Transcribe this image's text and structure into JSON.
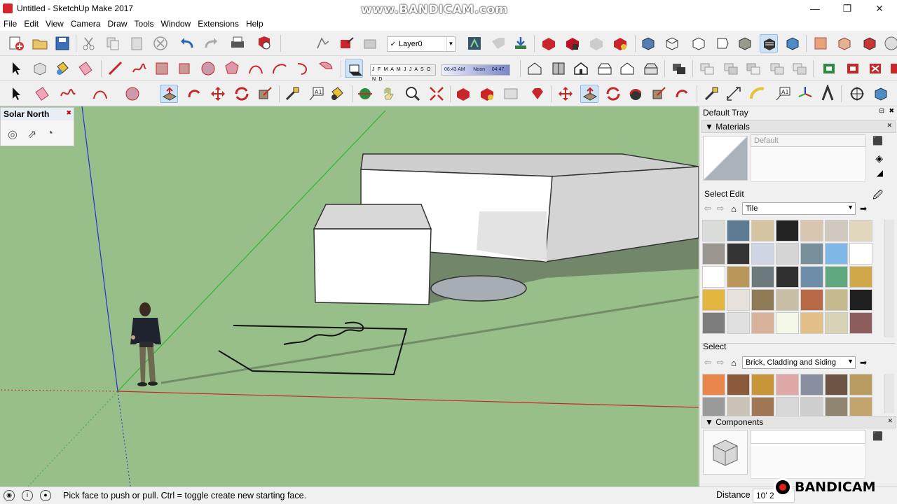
{
  "window": {
    "title": "Untitled - SketchUp Make 2017"
  },
  "watermark": {
    "top": "www.BANDICAM.com",
    "bottom": "BANDICAM"
  },
  "menu": [
    "File",
    "Edit",
    "View",
    "Camera",
    "Draw",
    "Tools",
    "Window",
    "Extensions",
    "Help"
  ],
  "layers": {
    "current": "Layer0",
    "check": "✓"
  },
  "shadows": {
    "months": "J F M A M J J A S O N D",
    "time_start": "06:43 AM",
    "time_mid": "Noon",
    "time_end": "04:47"
  },
  "solar_north": {
    "title": "Solar North"
  },
  "tray": {
    "title": "Default Tray",
    "materials": {
      "header": "Materials",
      "name": "Default",
      "tab_select": "Select",
      "tab_edit": "Edit",
      "library": "Tile",
      "secondary_select": "Select",
      "secondary_library": "Brick, Cladding and Siding"
    },
    "components": {
      "header": "Components"
    }
  },
  "status": {
    "message": "Pick face to push or pull.  Ctrl = toggle create new starting face.",
    "distance_label": "Distance",
    "distance_value": "10' 2"
  },
  "colors": {
    "viewport_ground": "#98bf8a",
    "axis_red": "#c62828",
    "axis_green": "#2fb52f",
    "axis_blue": "#2233cc",
    "accent_active": "#cfe3f7"
  },
  "tile_swatches": [
    "#d9dcd9",
    "#5d7c93",
    "#d5c4a2",
    "#222",
    "#d8c6b0",
    "#cfc9c0",
    "#e1d7bd",
    "#9b9590",
    "#333",
    "#cfd7e6",
    "#d5d5d5",
    "#778f9a",
    "#7fb7e6",
    "#fff",
    "#fff",
    "#b9975a",
    "#6d7b7e",
    "#303030",
    "#6e8da8",
    "#5fa87f",
    "#d0a84a",
    "#e3b640",
    "#e7e2de",
    "#8f7c56",
    "#c8bea6",
    "#b86a46",
    "#c7b98e",
    "#202020",
    "#7d7d7d",
    "#e0e0e0",
    "#d8b29b",
    "#f3f8e8",
    "#e3c08a",
    "#d8d2b6",
    "#8e5e5e"
  ],
  "brick_swatches": [
    "#e8864b",
    "#8b5a3a",
    "#c89639",
    "#e0a9a9",
    "#8a8fa0",
    "#6b5443",
    "#b89c62",
    "#9a9a9a",
    "#c9c4b7",
    "#a17655",
    "#d8d8d8",
    "#cfcfcf",
    "#8f8571",
    "#c1a56c"
  ]
}
